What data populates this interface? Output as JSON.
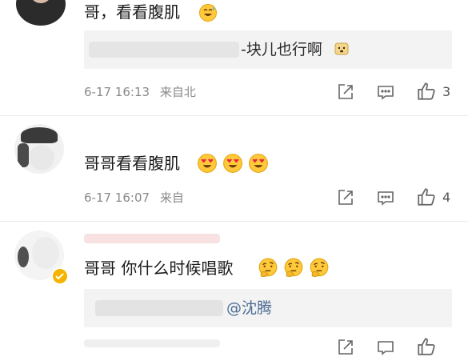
{
  "comments": [
    {
      "text": "哥，看看腹肌",
      "reply": {
        "text": "-块儿也行啊"
      },
      "date": "6-17 16:13",
      "source": "来自北",
      "likes": "3"
    },
    {
      "text": "哥哥看看腹肌",
      "date": "6-17 16:07",
      "source": "来自",
      "likes": "4"
    },
    {
      "text": "哥哥 你什么时候唱歌",
      "reply": {
        "mention": "@沈腾"
      }
    }
  ],
  "colors": {
    "mention": "#4e6c93",
    "reply_bg": "#f3f3f3",
    "meta_text": "#8a8a8a",
    "verified_badge": "#f5b400"
  },
  "icons": {
    "share": "share-icon",
    "comment": "comment-icon",
    "like": "thumbs-up-icon",
    "emoji_sweat": "sweat-smile-emoji",
    "emoji_heart_eyes": "heart-eyes-emoji",
    "emoji_thinking": "thinking-emoji",
    "emoji_dog": "dog-face-emoji"
  }
}
